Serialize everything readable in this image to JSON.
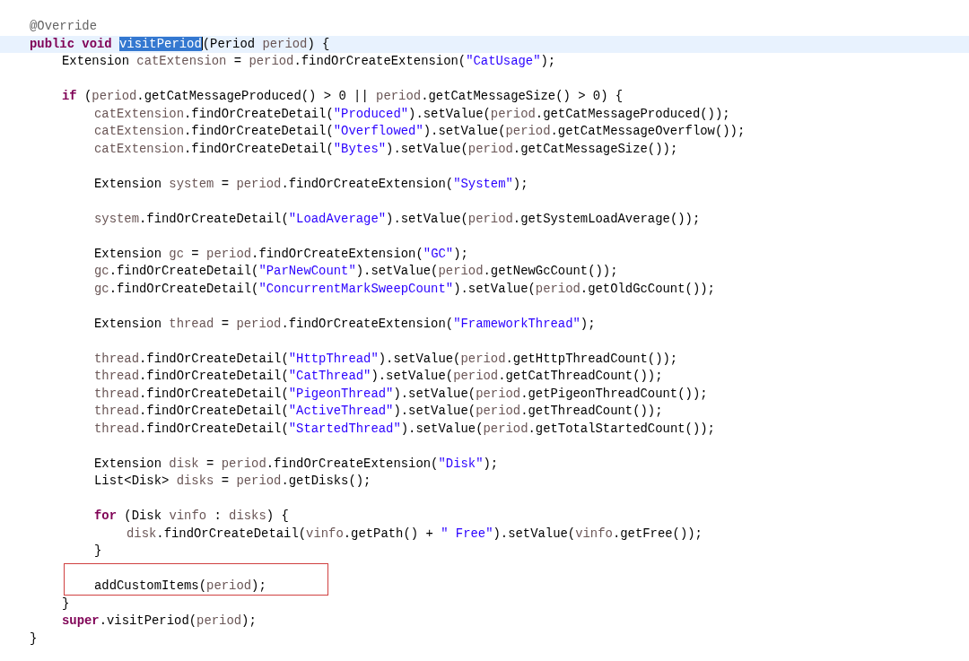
{
  "editor": {
    "lines": [
      {
        "kind": "code",
        "tokens": [
          {
            "kind": "annotation",
            "text": "@Override"
          }
        ]
      },
      {
        "kind": "code",
        "current": true,
        "tokens": [
          {
            "kind": "keyword",
            "text": "public void"
          },
          {
            "kind": "selection",
            "text": "visitPeriod"
          },
          {
            "kind": "plain",
            "text": "(Period "
          },
          {
            "kind": "variable",
            "text": "period"
          },
          {
            "kind": "plain",
            "text": ") {"
          }
        ],
        "children": [
          {
            "kind": "code",
            "tokens": [
              {
                "kind": "plain",
                "text": "Extension "
              },
              {
                "kind": "variable",
                "text": "catExtension"
              },
              {
                "kind": "plain",
                "text": " = "
              },
              {
                "kind": "variable",
                "text": "period"
              },
              {
                "kind": "plain",
                "text": ".findOrCreateExtension("
              },
              {
                "kind": "string",
                "text": "\"CatUsage\""
              },
              {
                "kind": "plain",
                "text": ");"
              }
            ]
          },
          {
            "kind": "blank"
          },
          {
            "kind": "code",
            "tokens": [
              {
                "kind": "keyword",
                "text": "if"
              },
              {
                "kind": "plain",
                "text": " ("
              },
              {
                "kind": "variable",
                "text": "period"
              },
              {
                "kind": "plain",
                "text": ".getCatMessageProduced() > 0 || "
              },
              {
                "kind": "variable",
                "text": "period"
              },
              {
                "kind": "plain",
                "text": ".getCatMessageSize() > 0) {"
              }
            ],
            "children": [
              {
                "kind": "code",
                "tokens": [
                  {
                    "kind": "variable",
                    "text": "catExtension"
                  },
                  {
                    "kind": "plain",
                    "text": ".findOrCreateDetail("
                  },
                  {
                    "kind": "string",
                    "text": "\"Produced\""
                  },
                  {
                    "kind": "plain",
                    "text": ").setValue("
                  },
                  {
                    "kind": "variable",
                    "text": "period"
                  },
                  {
                    "kind": "plain",
                    "text": ".getCatMessageProduced());"
                  }
                ]
              },
              {
                "kind": "code",
                "tokens": [
                  {
                    "kind": "variable",
                    "text": "catExtension"
                  },
                  {
                    "kind": "plain",
                    "text": ".findOrCreateDetail("
                  },
                  {
                    "kind": "string",
                    "text": "\"Overflowed\""
                  },
                  {
                    "kind": "plain",
                    "text": ").setValue("
                  },
                  {
                    "kind": "variable",
                    "text": "period"
                  },
                  {
                    "kind": "plain",
                    "text": ".getCatMessageOverflow());"
                  }
                ]
              },
              {
                "kind": "code",
                "tokens": [
                  {
                    "kind": "variable",
                    "text": "catExtension"
                  },
                  {
                    "kind": "plain",
                    "text": ".findOrCreateDetail("
                  },
                  {
                    "kind": "string",
                    "text": "\"Bytes\""
                  },
                  {
                    "kind": "plain",
                    "text": ").setValue("
                  },
                  {
                    "kind": "variable",
                    "text": "period"
                  },
                  {
                    "kind": "plain",
                    "text": ".getCatMessageSize());"
                  }
                ]
              },
              {
                "kind": "blank"
              },
              {
                "kind": "code",
                "tokens": [
                  {
                    "kind": "plain",
                    "text": "Extension "
                  },
                  {
                    "kind": "variable",
                    "text": "system"
                  },
                  {
                    "kind": "plain",
                    "text": " = "
                  },
                  {
                    "kind": "variable",
                    "text": "period"
                  },
                  {
                    "kind": "plain",
                    "text": ".findOrCreateExtension("
                  },
                  {
                    "kind": "string",
                    "text": "\"System\""
                  },
                  {
                    "kind": "plain",
                    "text": ");"
                  }
                ]
              },
              {
                "kind": "blank"
              },
              {
                "kind": "code",
                "tokens": [
                  {
                    "kind": "variable",
                    "text": "system"
                  },
                  {
                    "kind": "plain",
                    "text": ".findOrCreateDetail("
                  },
                  {
                    "kind": "string",
                    "text": "\"LoadAverage\""
                  },
                  {
                    "kind": "plain",
                    "text": ").setValue("
                  },
                  {
                    "kind": "variable",
                    "text": "period"
                  },
                  {
                    "kind": "plain",
                    "text": ".getSystemLoadAverage());"
                  }
                ]
              },
              {
                "kind": "blank"
              },
              {
                "kind": "code",
                "tokens": [
                  {
                    "kind": "plain",
                    "text": "Extension "
                  },
                  {
                    "kind": "variable",
                    "text": "gc"
                  },
                  {
                    "kind": "plain",
                    "text": " = "
                  },
                  {
                    "kind": "variable",
                    "text": "period"
                  },
                  {
                    "kind": "plain",
                    "text": ".findOrCreateExtension("
                  },
                  {
                    "kind": "string",
                    "text": "\"GC\""
                  },
                  {
                    "kind": "plain",
                    "text": ");"
                  }
                ]
              },
              {
                "kind": "code",
                "tokens": [
                  {
                    "kind": "variable",
                    "text": "gc"
                  },
                  {
                    "kind": "plain",
                    "text": ".findOrCreateDetail("
                  },
                  {
                    "kind": "string",
                    "text": "\"ParNewCount\""
                  },
                  {
                    "kind": "plain",
                    "text": ").setValue("
                  },
                  {
                    "kind": "variable",
                    "text": "period"
                  },
                  {
                    "kind": "plain",
                    "text": ".getNewGcCount());"
                  }
                ]
              },
              {
                "kind": "code",
                "tokens": [
                  {
                    "kind": "variable",
                    "text": "gc"
                  },
                  {
                    "kind": "plain",
                    "text": ".findOrCreateDetail("
                  },
                  {
                    "kind": "string",
                    "text": "\"ConcurrentMarkSweepCount\""
                  },
                  {
                    "kind": "plain",
                    "text": ").setValue("
                  },
                  {
                    "kind": "variable",
                    "text": "period"
                  },
                  {
                    "kind": "plain",
                    "text": ".getOldGcCount());"
                  }
                ]
              },
              {
                "kind": "blank"
              },
              {
                "kind": "code",
                "tokens": [
                  {
                    "kind": "plain",
                    "text": "Extension "
                  },
                  {
                    "kind": "variable",
                    "text": "thread"
                  },
                  {
                    "kind": "plain",
                    "text": " = "
                  },
                  {
                    "kind": "variable",
                    "text": "period"
                  },
                  {
                    "kind": "plain",
                    "text": ".findOrCreateExtension("
                  },
                  {
                    "kind": "string",
                    "text": "\"FrameworkThread\""
                  },
                  {
                    "kind": "plain",
                    "text": ");"
                  }
                ]
              },
              {
                "kind": "blank"
              },
              {
                "kind": "code",
                "tokens": [
                  {
                    "kind": "variable",
                    "text": "thread"
                  },
                  {
                    "kind": "plain",
                    "text": ".findOrCreateDetail("
                  },
                  {
                    "kind": "string",
                    "text": "\"HttpThread\""
                  },
                  {
                    "kind": "plain",
                    "text": ").setValue("
                  },
                  {
                    "kind": "variable",
                    "text": "period"
                  },
                  {
                    "kind": "plain",
                    "text": ".getHttpThreadCount());"
                  }
                ]
              },
              {
                "kind": "code",
                "tokens": [
                  {
                    "kind": "variable",
                    "text": "thread"
                  },
                  {
                    "kind": "plain",
                    "text": ".findOrCreateDetail("
                  },
                  {
                    "kind": "string",
                    "text": "\"CatThread\""
                  },
                  {
                    "kind": "plain",
                    "text": ").setValue("
                  },
                  {
                    "kind": "variable",
                    "text": "period"
                  },
                  {
                    "kind": "plain",
                    "text": ".getCatThreadCount());"
                  }
                ]
              },
              {
                "kind": "code",
                "tokens": [
                  {
                    "kind": "variable",
                    "text": "thread"
                  },
                  {
                    "kind": "plain",
                    "text": ".findOrCreateDetail("
                  },
                  {
                    "kind": "string",
                    "text": "\"PigeonThread\""
                  },
                  {
                    "kind": "plain",
                    "text": ").setValue("
                  },
                  {
                    "kind": "variable",
                    "text": "period"
                  },
                  {
                    "kind": "plain",
                    "text": ".getPigeonThreadCount());"
                  }
                ]
              },
              {
                "kind": "code",
                "tokens": [
                  {
                    "kind": "variable",
                    "text": "thread"
                  },
                  {
                    "kind": "plain",
                    "text": ".findOrCreateDetail("
                  },
                  {
                    "kind": "string",
                    "text": "\"ActiveThread\""
                  },
                  {
                    "kind": "plain",
                    "text": ").setValue("
                  },
                  {
                    "kind": "variable",
                    "text": "period"
                  },
                  {
                    "kind": "plain",
                    "text": ".getThreadCount());"
                  }
                ]
              },
              {
                "kind": "code",
                "tokens": [
                  {
                    "kind": "variable",
                    "text": "thread"
                  },
                  {
                    "kind": "plain",
                    "text": ".findOrCreateDetail("
                  },
                  {
                    "kind": "string",
                    "text": "\"StartedThread\""
                  },
                  {
                    "kind": "plain",
                    "text": ").setValue("
                  },
                  {
                    "kind": "variable",
                    "text": "period"
                  },
                  {
                    "kind": "plain",
                    "text": ".getTotalStartedCount());"
                  }
                ]
              },
              {
                "kind": "blank"
              },
              {
                "kind": "code",
                "tokens": [
                  {
                    "kind": "plain",
                    "text": "Extension "
                  },
                  {
                    "kind": "variable",
                    "text": "disk"
                  },
                  {
                    "kind": "plain",
                    "text": " = "
                  },
                  {
                    "kind": "variable",
                    "text": "period"
                  },
                  {
                    "kind": "plain",
                    "text": ".findOrCreateExtension("
                  },
                  {
                    "kind": "string",
                    "text": "\"Disk\""
                  },
                  {
                    "kind": "plain",
                    "text": ");"
                  }
                ]
              },
              {
                "kind": "code",
                "tokens": [
                  {
                    "kind": "plain",
                    "text": "List<Disk> "
                  },
                  {
                    "kind": "variable",
                    "text": "disks"
                  },
                  {
                    "kind": "plain",
                    "text": " = "
                  },
                  {
                    "kind": "variable",
                    "text": "period"
                  },
                  {
                    "kind": "plain",
                    "text": ".getDisks();"
                  }
                ]
              },
              {
                "kind": "blank"
              },
              {
                "kind": "code",
                "tokens": [
                  {
                    "kind": "keyword",
                    "text": "for"
                  },
                  {
                    "kind": "plain",
                    "text": " (Disk "
                  },
                  {
                    "kind": "variable",
                    "text": "vinfo"
                  },
                  {
                    "kind": "plain",
                    "text": " : "
                  },
                  {
                    "kind": "variable",
                    "text": "disks"
                  },
                  {
                    "kind": "plain",
                    "text": ") {"
                  }
                ],
                "children": [
                  {
                    "kind": "code",
                    "tokens": [
                      {
                        "kind": "variable",
                        "text": "disk"
                      },
                      {
                        "kind": "plain",
                        "text": ".findOrCreateDetail("
                      },
                      {
                        "kind": "variable",
                        "text": "vinfo"
                      },
                      {
                        "kind": "plain",
                        "text": ".getPath() + "
                      },
                      {
                        "kind": "string",
                        "text": "\" Free\""
                      },
                      {
                        "kind": "plain",
                        "text": ").setValue("
                      },
                      {
                        "kind": "variable",
                        "text": "vinfo"
                      },
                      {
                        "kind": "plain",
                        "text": ".getFree());"
                      }
                    ]
                  }
                ]
              },
              {
                "kind": "code",
                "tokens": [
                  {
                    "kind": "plain",
                    "text": "}"
                  }
                ]
              },
              {
                "kind": "blank"
              },
              {
                "kind": "code",
                "boxed": true,
                "tokens": [
                  {
                    "kind": "plain",
                    "text": "addCustomItems("
                  },
                  {
                    "kind": "variable",
                    "text": "period"
                  },
                  {
                    "kind": "plain",
                    "text": ");"
                  }
                ]
              }
            ]
          },
          {
            "kind": "code",
            "tokens": [
              {
                "kind": "plain",
                "text": "}"
              }
            ]
          },
          {
            "kind": "code",
            "tokens": [
              {
                "kind": "keyword",
                "text": "super"
              },
              {
                "kind": "plain",
                "text": ".visitPeriod("
              },
              {
                "kind": "variable",
                "text": "period"
              },
              {
                "kind": "plain",
                "text": ");"
              }
            ]
          }
        ]
      },
      {
        "kind": "code",
        "tokens": [
          {
            "kind": "plain",
            "text": "}"
          }
        ]
      }
    ]
  }
}
